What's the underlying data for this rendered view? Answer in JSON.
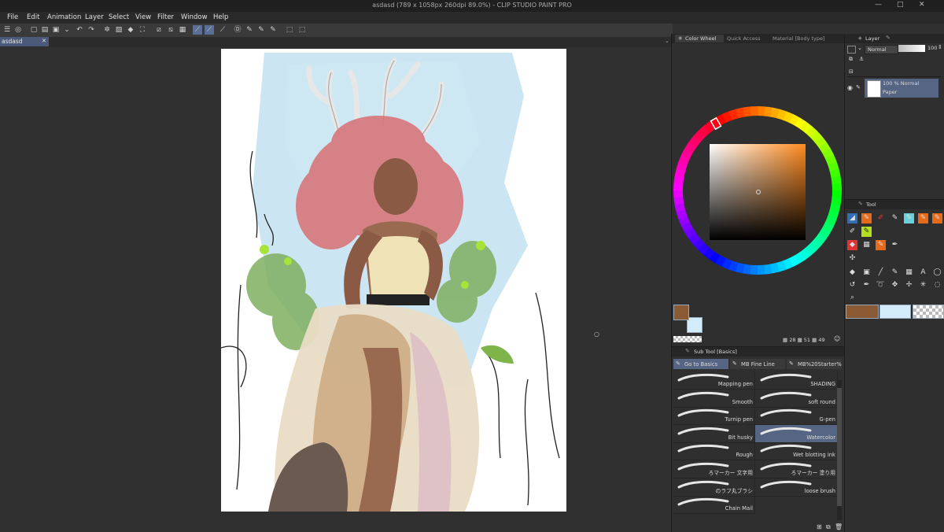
{
  "window": {
    "title": "asdasd (789 x 1058px 260dpi 89.0%) - CLIP STUDIO PAINT PRO"
  },
  "menu": [
    "File",
    "Edit",
    "Animation",
    "Layer",
    "Select",
    "View",
    "Filter",
    "Window",
    "Help"
  ],
  "document_tab": "asdasd",
  "color_panel": {
    "tabs": [
      "Color Wheel",
      "Quick Access",
      "Material [Body type]"
    ],
    "main_color": "#8a5a34",
    "sub_color": "#d3ecfa",
    "readout": {
      "h": "28",
      "s": "51",
      "v": "49"
    }
  },
  "layer_panel": {
    "title": "Layer",
    "blend_mode": "Normal",
    "opacity": "100",
    "layer": {
      "info": "100 % Normal",
      "name": "Paper"
    }
  },
  "tool_panel": {
    "title": "Tool",
    "swatch_main": "#8a5a34",
    "swatch_sub": "#d3ecfa"
  },
  "subtool_panel": {
    "title": "Sub Tool [Basics]",
    "tabs": [
      "Go to Basics",
      "MB Fine Line",
      "MB%20Starter%20"
    ],
    "brushes_left": [
      "Mapping pen",
      "Smooth",
      "Turnip pen",
      "Bit husky",
      "Rough",
      "ろマーカー 文字用",
      "のラフ丸ブラシ",
      "Chain Mail"
    ],
    "brushes_right": [
      "SHADING",
      "soft round",
      "G-pen",
      "Watercolor",
      "Wet blotting ink",
      "ろマーカー 塗り用",
      "loose brush"
    ]
  }
}
